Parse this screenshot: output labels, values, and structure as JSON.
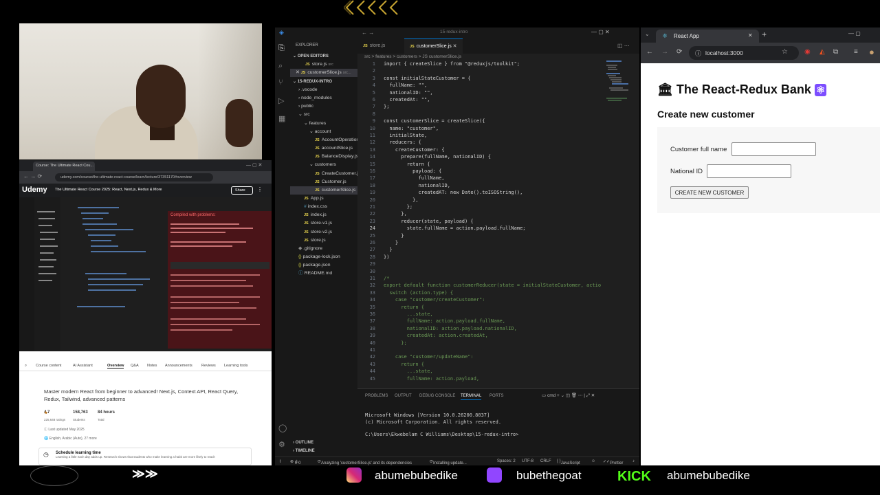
{
  "vscode": {
    "title": "15-redux-intro",
    "explorer_title": "EXPLORER",
    "open_editors_label": "OPEN EDITORS",
    "open_editors": [
      {
        "name": "store.js",
        "path": "src"
      },
      {
        "name": "customerSlice.js",
        "path": "src..."
      }
    ],
    "project_label": "15-REDUX-INTRO",
    "tree": [
      {
        "name": ".vscode",
        "kind": "folder",
        "depth": 1
      },
      {
        "name": "node_modules",
        "kind": "folder",
        "depth": 1
      },
      {
        "name": "public",
        "kind": "folder",
        "depth": 1
      },
      {
        "name": "src",
        "kind": "folder-open",
        "depth": 1
      },
      {
        "name": "features",
        "kind": "folder-open",
        "depth": 2
      },
      {
        "name": "account",
        "kind": "folder-open",
        "depth": 3
      },
      {
        "name": "AccountOperation...",
        "kind": "js",
        "depth": 4
      },
      {
        "name": "accountSlice.js",
        "kind": "js",
        "depth": 4
      },
      {
        "name": "BalanceDisplay.js",
        "kind": "js",
        "depth": 4
      },
      {
        "name": "customers",
        "kind": "folder-open",
        "depth": 3
      },
      {
        "name": "CreateCustomer.js",
        "kind": "js",
        "depth": 4
      },
      {
        "name": "Customer.js",
        "kind": "js",
        "depth": 4
      },
      {
        "name": "customerSlice.js",
        "kind": "js",
        "depth": 4,
        "selected": true
      },
      {
        "name": "App.js",
        "kind": "js",
        "depth": 2
      },
      {
        "name": "index.css",
        "kind": "css",
        "depth": 2
      },
      {
        "name": "index.js",
        "kind": "js",
        "depth": 2
      },
      {
        "name": "store-v1.js",
        "kind": "js",
        "depth": 2
      },
      {
        "name": "store-v2.js",
        "kind": "js",
        "depth": 2
      },
      {
        "name": "store.js",
        "kind": "js",
        "depth": 2
      },
      {
        "name": ".gitignore",
        "kind": "file",
        "depth": 1
      },
      {
        "name": "package-lock.json",
        "kind": "json",
        "depth": 1
      },
      {
        "name": "package.json",
        "kind": "json",
        "depth": 1
      },
      {
        "name": "README.md",
        "kind": "md",
        "depth": 1
      }
    ],
    "outline_label": "OUTLINE",
    "timeline_label": "TIMELINE",
    "tabs": [
      {
        "name": "store.js",
        "active": false
      },
      {
        "name": "customerSlice.js",
        "active": true
      }
    ],
    "breadcrumb": "src > features > customers > JS customerSlice.js",
    "code_lines": [
      "import { createSlice } from \"@reduxjs/toolkit\";",
      "",
      "const initialStateCustomer = {",
      "  fullName: \"\",",
      "  nationalID: \"\",",
      "  createdAt: \"\",",
      "};",
      "",
      "const customerSlice = createSlice({",
      "  name: \"customer\",",
      "  initialState,",
      "  reducers: {",
      "    createCustomer: {",
      "      prepare(fullName, nationalID) {",
      "        return {",
      "          payload: {",
      "            fullName,",
      "            nationalID,",
      "            createdAT: new Date().toISOString(),",
      "          },",
      "        };",
      "      },",
      "      reducer(state, payload) {",
      "        state.fullName = action.payload.fullName;",
      "      }",
      "    }",
      "  }",
      "})",
      "",
      "",
      "/*",
      "export default function customerReducer(state = initialStateCustomer, actio",
      "  switch (action.type) {",
      "    case \"customer/createCustomer\":",
      "      return {",
      "        ...state,",
      "        fullName: action.payload.fullName,",
      "        nationalID: action.payload.nationalID,",
      "        createdAt: action.createdAt,",
      "      };",
      "",
      "    case \"customer/updateName\":",
      "      return {",
      "        ...state,",
      "        fullName: action.payload,"
    ],
    "current_line": 24,
    "panel_tabs": [
      "PROBLEMS",
      "OUTPUT",
      "DEBUG CONSOLE",
      "TERMINAL",
      "PORTS"
    ],
    "panel_active": "TERMINAL",
    "terminal_shell": "cmd",
    "terminal_lines": [
      "Microsoft Windows [Version 10.0.26200.8037]",
      "(c) Microsoft Corporation. All rights reserved.",
      "",
      "C:\\Users\\Ekwebelam C Williams\\Desktop\\15-redux-intro>"
    ],
    "status": {
      "errors": "0",
      "warnings": "0",
      "analyzing": "Analyzing 'customerSlice.js' and its dependencies",
      "installing": "Installing update...",
      "spaces": "Spaces: 2",
      "encoding": "UTF-8",
      "eol": "CRLF",
      "language": "JavaScript",
      "prettier": "Prettier"
    }
  },
  "browser": {
    "tab_title": "React App",
    "url": "localhost:3000",
    "app_title": "The React-Redux Bank",
    "section_title": "Create new customer",
    "full_name_label": "Customer full name",
    "full_name_value": "",
    "national_id_label": "National ID",
    "national_id_value": "",
    "create_button": "CREATE NEW CUSTOMER"
  },
  "udemy": {
    "tab_title": "Course: The Ultimate React Cou...",
    "url": "udemy.com/course/the-ultimate-react-course/learn/lecture/37351170#overview",
    "logo": "Udemy",
    "course_title": "The Ultimate React Course 2025: React, Next.js, Redux & More",
    "share_label": "Share",
    "compiled_label": "Compiled with problems:",
    "tabs": [
      "Course content",
      "AI Assistant",
      "Overview",
      "Q&A",
      "Notes",
      "Announcements",
      "Reviews",
      "Learning tools"
    ],
    "active_tab": "Overview",
    "description": "Master modern React from beginner to advanced! Next.js, Context API, React Query, Redux, Tailwind, advanced patterns",
    "rating": "4.7",
    "ratings_count": "225,648 ratings",
    "students": "158,763",
    "students_label": "Students",
    "hours": "84 hours",
    "hours_label": "Total",
    "last_updated": "Last updated May 2025",
    "languages": "English, Arabic (Auto), 27 more",
    "schedule_title": "Schedule learning time",
    "schedule_text": "Learning a little each day adds up. Research shows that students who make learning a habit are more likely to reach"
  },
  "socials": {
    "instagram": "abumebubedike",
    "twitch": "bubethegoat",
    "kick_logo": "KICK",
    "kick": "abumebubedike"
  },
  "colors": {
    "vscode_bg": "#1f1f1f",
    "accent": "#0078d4",
    "instagram": "#d6249f",
    "twitch": "#9146ff",
    "kick": "#53fc18",
    "react": "#7c4dff"
  }
}
